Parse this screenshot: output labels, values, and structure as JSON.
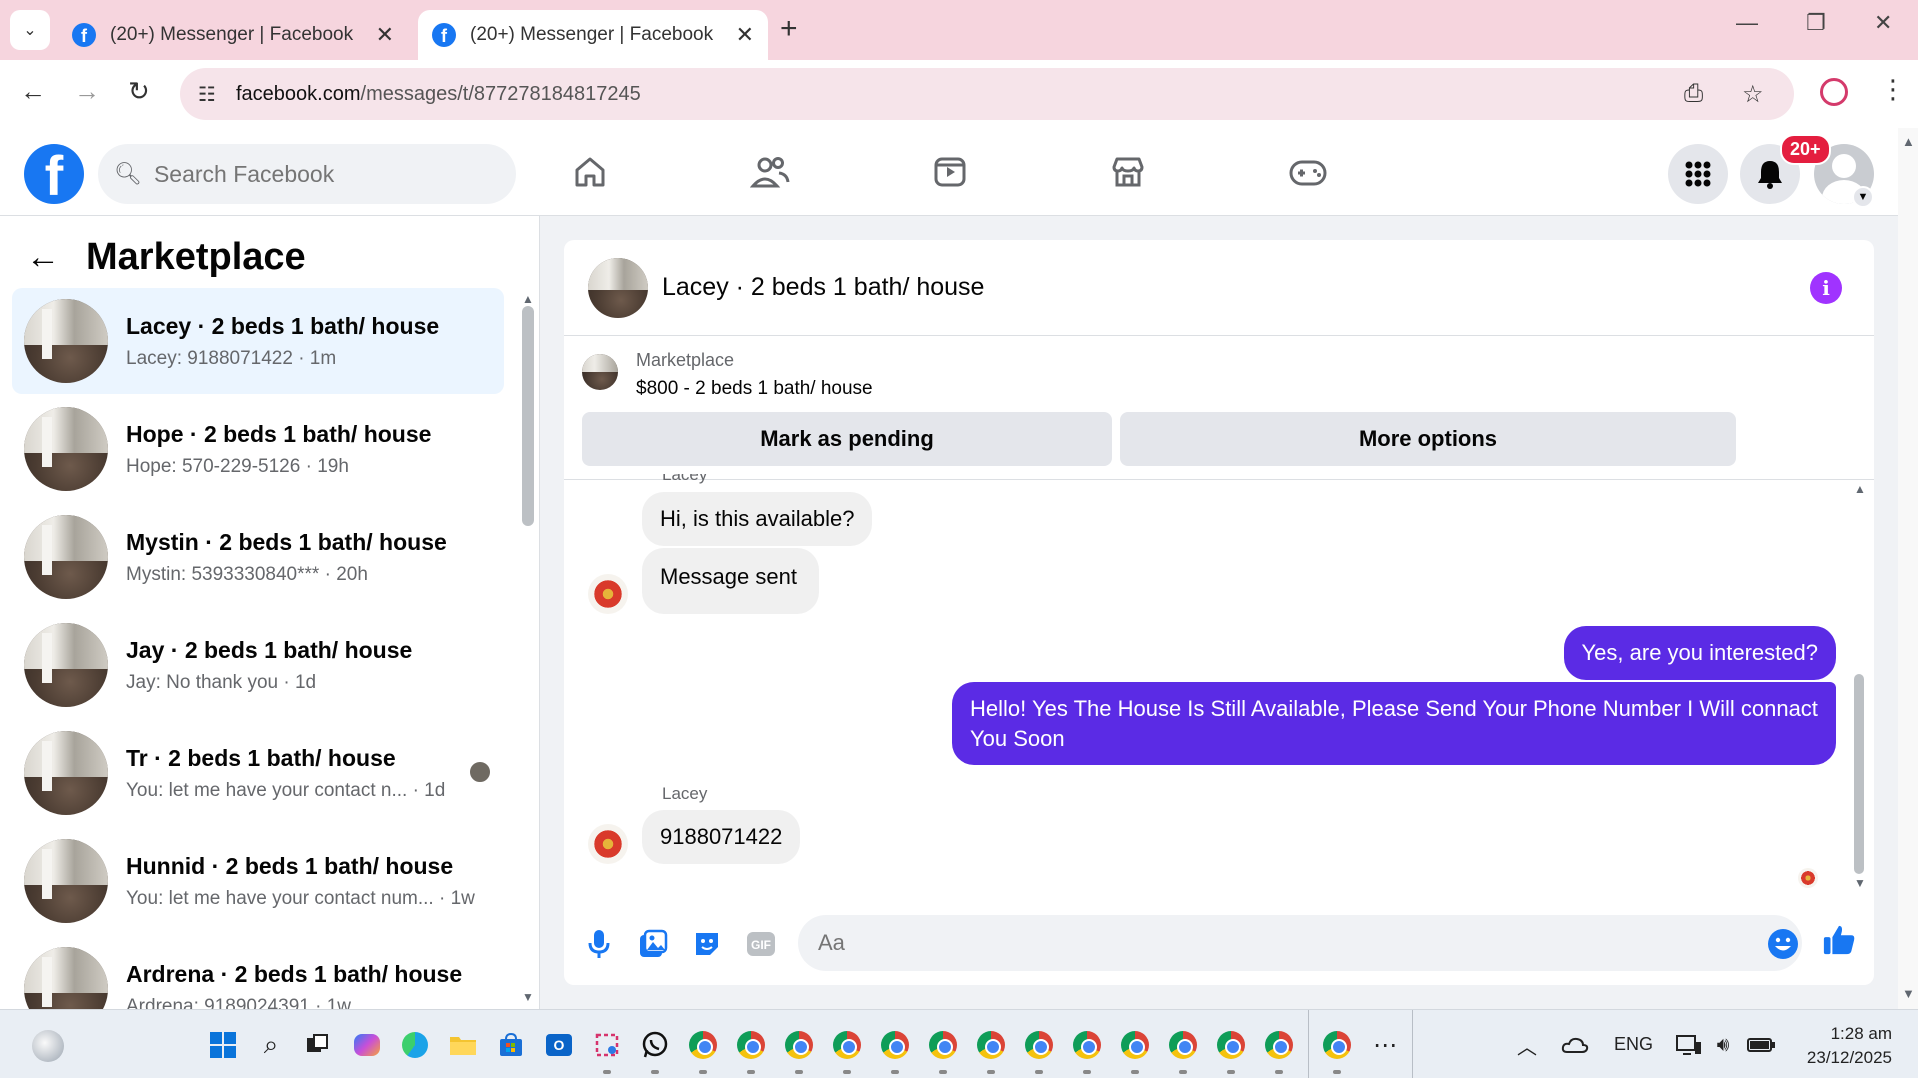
{
  "browser": {
    "tabs": [
      {
        "title": "(20+) Messenger | Facebook"
      },
      {
        "title": "(20+) Messenger | Facebook"
      }
    ],
    "url_host": "facebook.com",
    "url_path": "/messages/t/877278184817245"
  },
  "fb_header": {
    "search_placeholder": "Search Facebook",
    "notification_badge": "20+"
  },
  "left_panel": {
    "title": "Marketplace",
    "conversations": [
      {
        "name": "Lacey · 2 beds 1 bath/ house",
        "preview": "Lacey: 9188071422 · 1m",
        "active": true
      },
      {
        "name": "Hope · 2 beds 1 bath/ house",
        "preview": "Hope: 570-229-5126 · 19h",
        "active": false
      },
      {
        "name": "Mystin · 2 beds 1 bath/ house",
        "preview": "Mystin: 5393330840*** · 20h",
        "active": false
      },
      {
        "name": "Jay · 2 beds 1 bath/ house",
        "preview": "Jay: No thank you · 1d",
        "active": false
      },
      {
        "name": "Tr · 2 beds 1 bath/ house",
        "preview": "You: let me have your contact n... · 1d",
        "active": false
      },
      {
        "name": "Hunnid · 2 beds 1 bath/ house",
        "preview": "You: let me have your contact num... · 1w",
        "active": false
      },
      {
        "name": "Ardrena · 2 beds 1 bath/ house",
        "preview": "Ardrena: 9189024391 · 1w",
        "active": false
      }
    ]
  },
  "chat": {
    "title": "Lacey · 2 beds 1 bath/ house",
    "marketplace_label": "Marketplace",
    "listing": "$800 - 2 beds 1 bath/ house",
    "mark_pending_label": "Mark as pending",
    "more_options_label": "More options",
    "top_sender_partial": "Lacey",
    "messages": [
      {
        "from": "them",
        "text": "Hi, is this available?"
      },
      {
        "from": "them",
        "text": "Message sent"
      },
      {
        "from": "me",
        "text": "Yes, are you interested?"
      },
      {
        "from": "me",
        "text": "Hello! Yes The House  Is Still Available, Please Send Your Phone Number I Will connact You Soon"
      },
      {
        "from": "them",
        "sender": "Lacey",
        "text": "9188071422"
      }
    ],
    "composer_placeholder": "Aa"
  },
  "taskbar": {
    "language": "ENG",
    "time": "1:28 am",
    "date": "23/12/2025"
  },
  "colors": {
    "fb_blue": "#1877f2",
    "outgoing_bubble": "#5b2be5",
    "info_purple": "#a033ff",
    "badge_red": "#e41e3f",
    "tab_strip": "#f6d5de"
  }
}
